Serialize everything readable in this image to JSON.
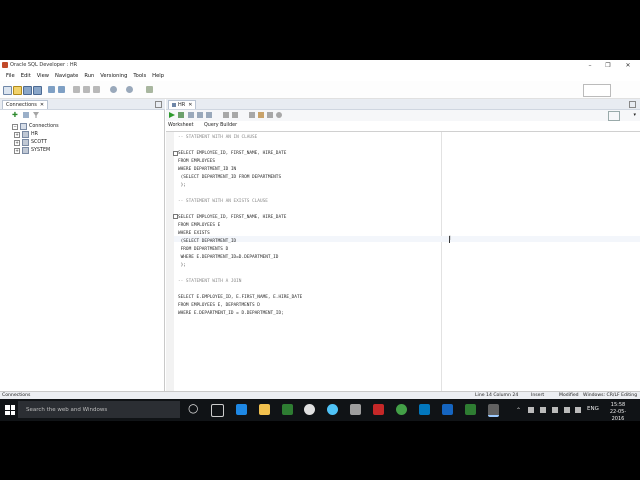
{
  "window": {
    "title": "Oracle SQL Developer : HR"
  },
  "menu": [
    "File",
    "Edit",
    "View",
    "Navigate",
    "Run",
    "Versioning",
    "Tools",
    "Help"
  ],
  "left_panel": {
    "tab": "Connections",
    "tree": {
      "root": "Connections",
      "items": [
        "HR",
        "SCOTT",
        "SYSTEM"
      ]
    }
  },
  "editor": {
    "tab": "HR",
    "subtabs": [
      "Worksheet",
      "Query Builder"
    ],
    "lines": [
      "-- STATEMENT WITH AN IN CLAUSE",
      "",
      "SELECT EMPLOYEE_ID, FIRST_NAME, HIRE_DATE",
      "FROM EMPLOYEES",
      "WHERE DEPARTMENT_ID IN",
      " (SELECT DEPARTMENT_ID FROM DEPARTMENTS",
      " );",
      "",
      "-- STATEMENT WITH AN EXISTS CLAUSE",
      "",
      "SELECT EMPLOYEE_ID, FIRST_NAME, HIRE_DATE",
      "FROM EMPLOYEES E",
      "WHERE EXISTS",
      " (SELECT DEPARTMENT_ID",
      " FROM DEPARTMENTS D",
      " WHERE E.DEPARTMENT_ID=D.DEPARTMENT_ID",
      " );",
      "",
      "-- STATEMENT WITH A JOIN",
      "",
      "SELECT E.EMPLOYEE_ID, E.FIRST_NAME, E.HIRE_DATE",
      "FROM EMPLOYEES E, DEPARTMENTS D",
      "WHERE E.DEPARTMENT_ID = D.DEPARTMENT_ID;"
    ]
  },
  "status": {
    "left": "Connections",
    "position": "Line 14 Column 24",
    "mode": "Insert",
    "modified": "Modified",
    "encoding": "Windows: CR/LF Editing"
  },
  "taskbar": {
    "search_placeholder": "Search the web and Windows",
    "lang": "ENG",
    "time": "15:58",
    "date": "22-05-2016"
  }
}
